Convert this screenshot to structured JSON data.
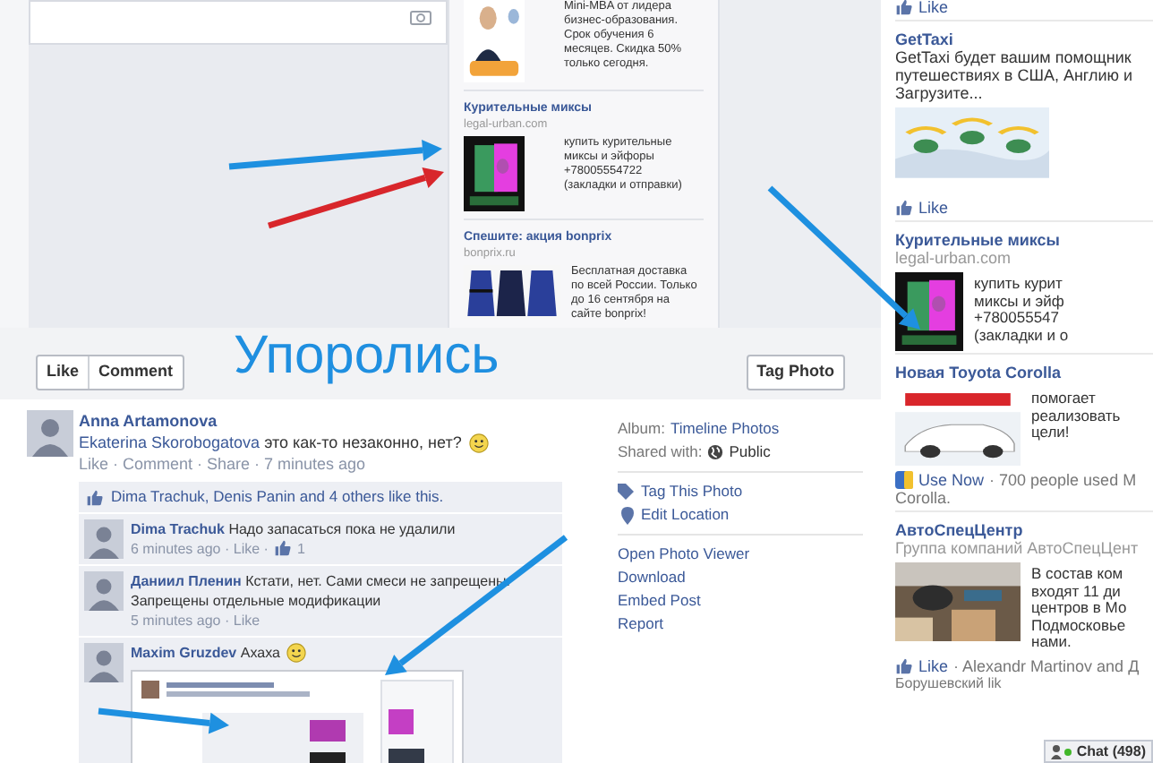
{
  "photo": {
    "ads": [
      {
        "kind": "mba",
        "lines": [
          "Mini-MBA от лидера",
          "бизнес-образования.",
          "Срок обучения 6",
          "месяцев. Скидка 50%",
          "только сегодня."
        ]
      },
      {
        "kind": "zombie",
        "title": "Курительные миксы",
        "domain": "legal-urban.com",
        "lines": [
          "купить курительные",
          "миксы и эйфоры",
          "+78005554722",
          "(закладки и отправки)"
        ]
      },
      {
        "kind": "dresses",
        "title": "Спешите: акция bonprix",
        "domain": "bonprix.ru",
        "lines": [
          "Бесплатная доставка",
          "по всей России. Только",
          "до 16 сентября на",
          "сайте bonprix!"
        ]
      }
    ]
  },
  "caption": "Упоролись",
  "actions": {
    "buttons": [
      "Like",
      "Comment"
    ],
    "tag_photo": "Tag Photo"
  },
  "post": {
    "author": "Anna Artamonova",
    "mention": "Ekaterina Skorobogatova",
    "text": "это как-то незаконно, нет?",
    "smiley": true,
    "meta": "Like · Comment · Share · 7 minutes ago"
  },
  "likes": "Dima Trachuk, Denis Panin and 4 others like this.",
  "comments": [
    {
      "author": "Dima Trachuk",
      "text": "Надо запасаться пока не удалили",
      "smiley": false,
      "meta": "6 minutes ago · Like ·",
      "like_count": "1",
      "attachment": false
    },
    {
      "author": "Даниил Пленин",
      "text": "Кстати, нет. Сами смеси не запрещены. Запрещены отдельные модификации",
      "smiley": false,
      "meta": "5 minutes ago · Like",
      "attachment": false
    },
    {
      "author": "Maxim Gruzdev",
      "text": "Ахаха",
      "smiley": true,
      "attachment": true
    }
  ],
  "info": {
    "album_label": "Album:",
    "album": "Timeline Photos",
    "shared_label": "Shared with:",
    "shared": "Public",
    "tools": [
      {
        "kind": "tag",
        "label": "Tag This Photo"
      },
      {
        "kind": "location",
        "label": "Edit Location"
      }
    ],
    "links": [
      "Open Photo Viewer",
      "Download",
      "Embed Post",
      "Report"
    ]
  },
  "sidebar": {
    "items": [
      {
        "kind": "like",
        "label": "Like"
      },
      {
        "kind": "ad",
        "title": "GetTaxi",
        "intro": [
          "GetTaxi будет вашим помощник",
          "путешествиях в США, Англию и",
          "Загрузите..."
        ]
      },
      {
        "kind": "like",
        "label": "Like"
      },
      {
        "kind": "ad",
        "title": "Курительные миксы",
        "domain": "legal-urban.com",
        "lines": [
          "купить курит",
          "миксы и эйф",
          "+780055547",
          "(закладки и о"
        ]
      },
      {
        "kind": "ad",
        "title": "Новая Toyota Corolla",
        "lines": [
          "помогает",
          "реализовать",
          "цели!"
        ]
      },
      {
        "kind": "usenow",
        "label": "Use Now",
        "text": "· 700 people used M",
        "more": "Corolla."
      },
      {
        "kind": "ad",
        "title": "АвтоСпецЦентр",
        "domain": "Группа компаний АвтоСпецЦент",
        "lines": [
          "В состав ком",
          "входят 11 ди",
          "центров в Мо",
          "Подмосковье",
          "нами."
        ]
      },
      {
        "kind": "like",
        "label": "Like",
        "text": "· Alexandr Martinov and Д",
        "more": "Борушевский lik"
      }
    ],
    "chat": "Chat (498)"
  }
}
